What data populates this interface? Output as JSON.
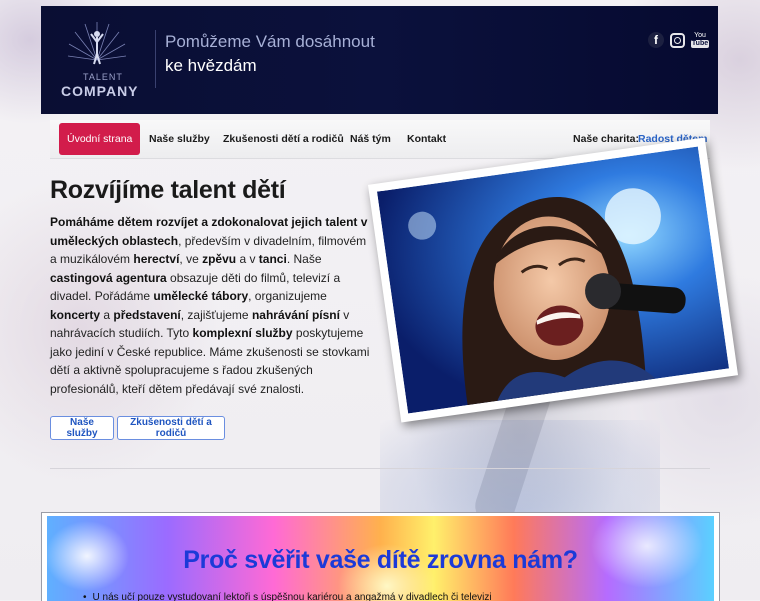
{
  "header": {
    "logo_small": "TALENT",
    "logo_big": "COMPANY",
    "slogan_line1": "Pomůžeme Vám dosáhnout",
    "slogan_line2": "ke hvězdám",
    "social": [
      {
        "name": "facebook-icon",
        "glyph": "f"
      },
      {
        "name": "instagram-icon",
        "glyph": ""
      },
      {
        "name": "youtube-icon",
        "glyph": "You Tube"
      }
    ],
    "yt_top": "You",
    "yt_bottom": "Tube"
  },
  "nav": {
    "items": [
      "Úvodní strana",
      "Naše služby",
      "Zkušenosti dětí a rodičů",
      "Náš tým",
      "Kontakt"
    ],
    "charity_label": "Naše charita:",
    "charity_link": "Radost dětem"
  },
  "main": {
    "title": "Rozvíjíme talent dětí",
    "p": [
      "Pomáháme dětem rozvíjet a zdokonalovat jejich talent v uměleckých oblastech",
      ", především v divadelním, filmovém a muzikálovém ",
      "herectví",
      ", ve ",
      "zpěvu",
      " a v ",
      "tanci",
      ". Naše ",
      "castingová agentura",
      " obsazuje děti do filmů, televizí a divadel. Pořádáme ",
      "umělecké tábory",
      ", organizujeme ",
      "koncerty",
      " a ",
      "představení",
      ", zajišťujeme ",
      "nahrávání písní",
      " v nahrávacích studiích. Tyto ",
      "komplexní služby",
      " poskytujeme jako jediní v České republice. Máme zkušenosti se stovkami dětí a aktivně spolupracujeme s řadou zkušených profesionálů, kteří dětem předávají své znalosti."
    ],
    "btn_services": "Naše služby",
    "btn_experience": "Zkušenosti dětí a rodičů"
  },
  "banner": {
    "title": "Proč svěřit vaše dítě zrovna nám?",
    "item1": "U nás učí pouze vystudovaní lektoři s úspěšnou kariérou a angažmá v divadlech či televizi"
  },
  "colors": {
    "header_bg": "#0b113c",
    "nav_active": "#d21c4b",
    "link_blue": "#2b64c6",
    "banner_title": "#1c3ad8"
  }
}
